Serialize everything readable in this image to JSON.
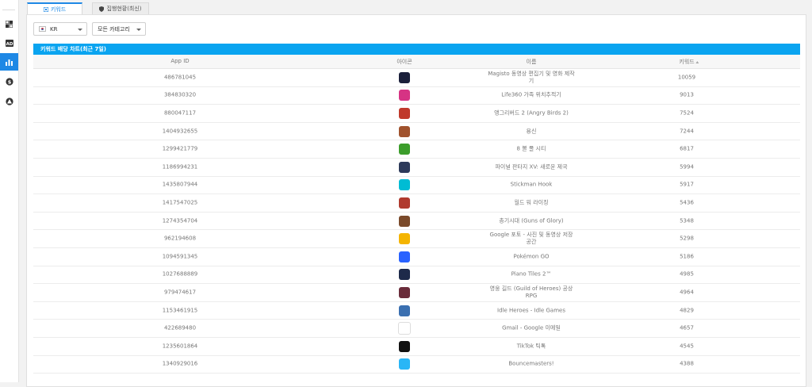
{
  "tabs": [
    {
      "label": "키워드",
      "icon": "grid-icon",
      "active": true
    },
    {
      "label": "집행현황(최신)",
      "icon": "shield-icon",
      "active": false
    }
  ],
  "filters": {
    "country": "KR",
    "category": "모든 카테고리"
  },
  "chart": {
    "title": "키워드 배당 차트(최근 7일)"
  },
  "table": {
    "columns": [
      "App ID",
      "아이콘",
      "이름",
      "키워드"
    ],
    "rows": [
      {
        "app_id": "486781045",
        "name": "Magisto 동영상 편집기 및 영화 제작기",
        "keyword": "10059",
        "icon": "magisto-app-icon",
        "color": "#1a1f3a"
      },
      {
        "app_id": "384830320",
        "name": "Life360 가족 위치추적기",
        "keyword": "9013",
        "icon": "life360-app-icon",
        "color": "#d63384"
      },
      {
        "app_id": "880047117",
        "name": "앵그리버드 2 (Angry Birds 2)",
        "keyword": "7524",
        "icon": "angry-birds-app-icon",
        "color": "#c0392b"
      },
      {
        "app_id": "1404932655",
        "name": "용신",
        "keyword": "7244",
        "icon": "game-app-icon",
        "color": "#a0522d"
      },
      {
        "app_id": "1299421779",
        "name": "8 볼 풀 시티",
        "keyword": "6817",
        "icon": "pool-app-icon",
        "color": "#3c9d2b"
      },
      {
        "app_id": "1186994231",
        "name": "파이널 판타지 XV: 새로운 제국",
        "keyword": "5994",
        "icon": "final-fantasy-app-icon",
        "color": "#2d3a5a"
      },
      {
        "app_id": "1435807944",
        "name": "Stickman Hook",
        "keyword": "5917",
        "icon": "stickman-app-icon",
        "color": "#00bcd4"
      },
      {
        "app_id": "1417547025",
        "name": "월드 워 라이징",
        "keyword": "5436",
        "icon": "war-app-icon",
        "color": "#b03a2e"
      },
      {
        "app_id": "1274354704",
        "name": "총기시대 (Guns of Glory)",
        "keyword": "5348",
        "icon": "guns-app-icon",
        "color": "#7a4a2a"
      },
      {
        "app_id": "962194608",
        "name": "Google 포토 - 사진 및 동영상 저장공간",
        "keyword": "5298",
        "icon": "google-photos-app-icon",
        "color": "#f4b400"
      },
      {
        "app_id": "1094591345",
        "name": "Pokémon GO",
        "keyword": "5186",
        "icon": "pokemon-app-icon",
        "color": "#2962ff"
      },
      {
        "app_id": "1027688889",
        "name": "Piano Tiles 2™",
        "keyword": "4985",
        "icon": "piano-app-icon",
        "color": "#1e2a4a"
      },
      {
        "app_id": "979474617",
        "name": "영웅 길드 (Guild of Heroes) 공상 RPG",
        "keyword": "4964",
        "icon": "guild-app-icon",
        "color": "#6a2c3a"
      },
      {
        "app_id": "1153461915",
        "name": "Idle Heroes - Idle Games",
        "keyword": "4829",
        "icon": "idle-heroes-app-icon",
        "color": "#3a6fb0"
      },
      {
        "app_id": "422689480",
        "name": "Gmail - Google 이메일",
        "keyword": "4657",
        "icon": "gmail-app-icon",
        "color": "#ffffff"
      },
      {
        "app_id": "1235601864",
        "name": "TikTok 틱톡",
        "keyword": "4545",
        "icon": "tiktok-app-icon",
        "color": "#111111"
      },
      {
        "app_id": "1340929016",
        "name": "Bouncemasters!",
        "keyword": "4388",
        "icon": "bounce-app-icon",
        "color": "#29b6f6"
      }
    ]
  },
  "colors": {
    "accent": "#1e88e5",
    "header_bar": "#0aa4f0"
  }
}
